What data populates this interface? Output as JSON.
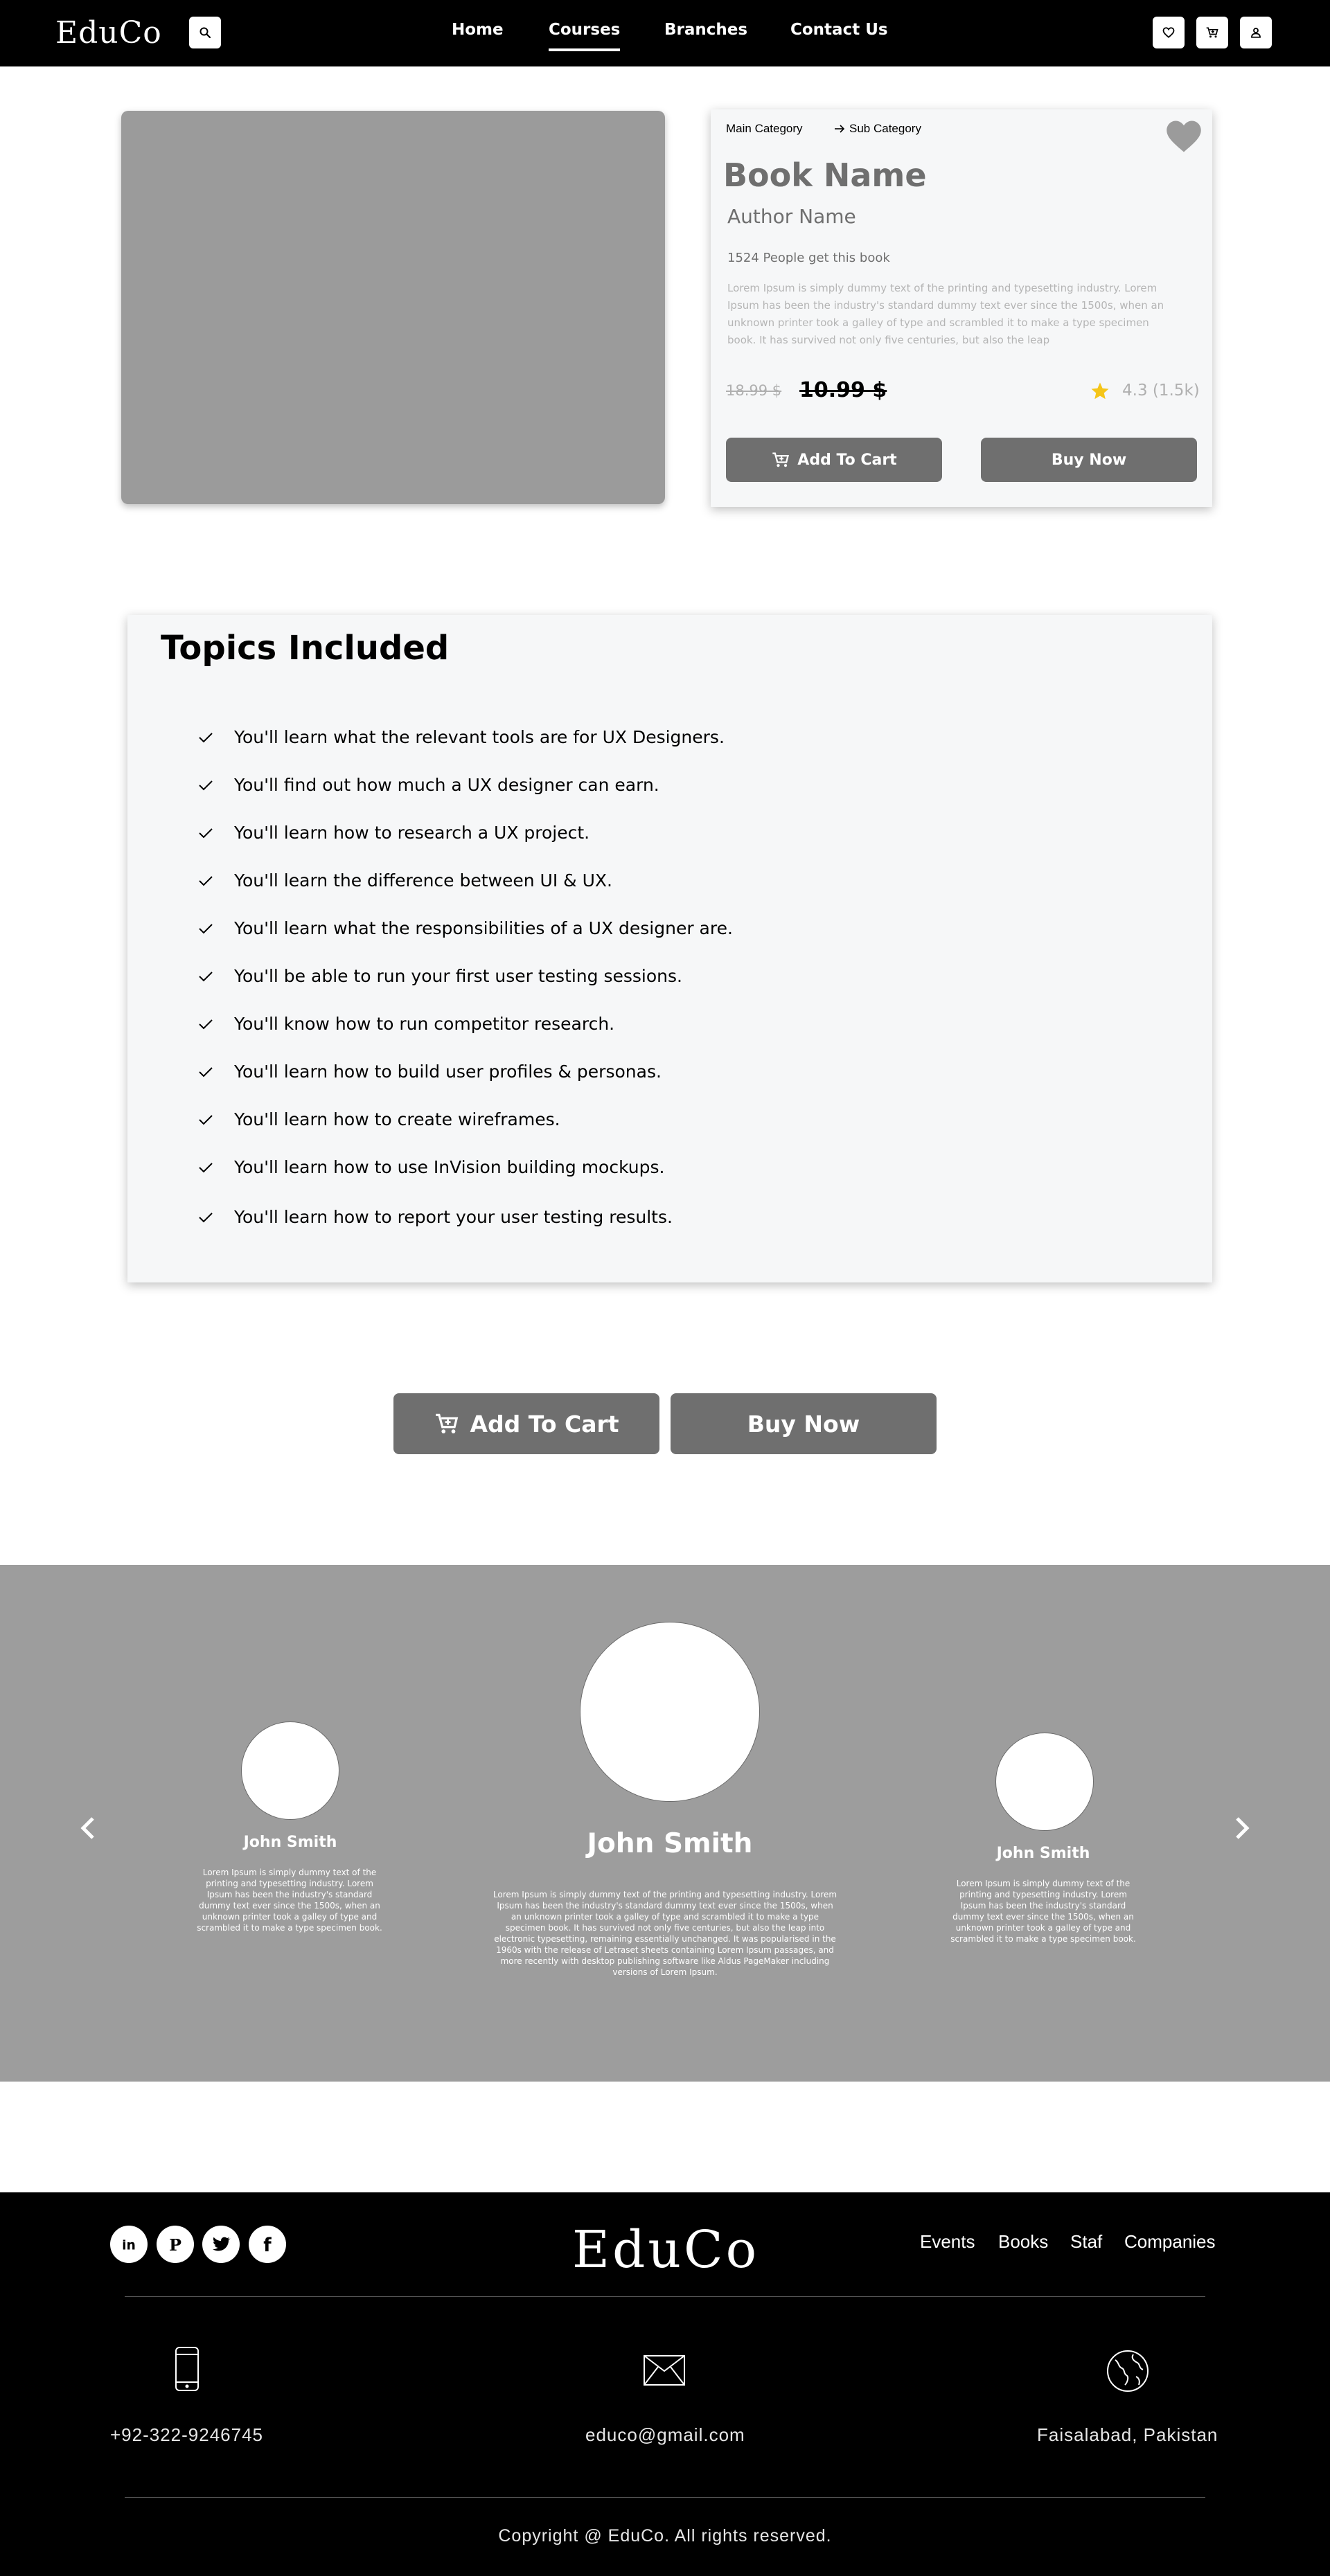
{
  "header": {
    "logo": "EduCo",
    "nav": [
      "Home",
      "Courses",
      "Branches",
      "Contact Us"
    ],
    "active_nav": "Courses",
    "icons": [
      "search-icon",
      "heart-icon",
      "cart-icon",
      "user-icon"
    ]
  },
  "product": {
    "breadcrumb_main": "Main Category",
    "breadcrumb_sub": "Sub Category",
    "book_name": "Book Name",
    "author_name": "Author Name",
    "people": "1524 People get this book",
    "description": "Lorem Ipsum is simply dummy text of the printing and typesetting industry. Lorem Ipsum has been the industry's standard dummy text ever since the 1500s, when an unknown printer took a galley of type and scrambled it to make a type specimen book. It has survived not only five centuries, but also the leap",
    "old_price": "18.99 $",
    "new_price": "10.99 $",
    "rating": "4.3 (1.5k)",
    "add_to_cart": "Add To Cart",
    "buy_now": "Buy Now",
    "accent_star": "#f5c518",
    "button_color": "#6f6f6f"
  },
  "topics": {
    "title": "Topics Included",
    "items": [
      "You'll learn what the relevant tools are for UX Designers.",
      "You'll find out how much a UX designer can earn.",
      "You'll learn how to research a UX project.",
      "You'll learn the difference between UI & UX.",
      "You'll learn what the responsibilities of a UX designer are.",
      "You'll be able to run your first user testing sessions.",
      "You'll know how to run competitor research.",
      "You'll learn how to build user profiles & personas.",
      "You'll learn how to create wireframes.",
      "You'll learn how to use InVision building mockups.",
      "You'll learn how to report your user testing results."
    ]
  },
  "actions": {
    "add_to_cart": "Add To Cart",
    "buy_now": "Buy Now"
  },
  "testimonials": {
    "left": {
      "name": "John Smith",
      "text": "Lorem Ipsum is simply dummy text of the printing and typesetting industry. Lorem Ipsum has been the industry's standard dummy text ever since the 1500s, when an unknown printer took a galley of type and scrambled it to make a type specimen book."
    },
    "center": {
      "name": "John Smith",
      "text": "Lorem Ipsum is simply dummy text of the printing and typesetting industry. Lorem Ipsum has been the industry's standard dummy text ever since the 1500s, when an unknown printer took a galley of type and scrambled it to make a type specimen book. It has survived not only five centuries, but also the leap into electronic typesetting, remaining essentially unchanged. It was popularised in the 1960s with the release of Letraset sheets containing Lorem Ipsum passages, and more recently with desktop publishing software like Aldus PageMaker including versions of Lorem Ipsum."
    },
    "right": {
      "name": "John Smith",
      "text": "Lorem Ipsum is simply dummy text of the printing and typesetting industry. Lorem Ipsum has been the industry's standard dummy text ever since the 1500s, when an unknown printer took a galley of type and scrambled it to make a type specimen book."
    },
    "background": "#9d9d9d"
  },
  "footer": {
    "logo": "EduCo",
    "social": [
      "linkedin-icon",
      "pinterest-icon",
      "twitter-icon",
      "facebook-icon"
    ],
    "links": [
      "Events",
      "Books",
      "Staf",
      "Companies"
    ],
    "phone": "+92-322-9246745",
    "email": "educo@gmail.com",
    "location": "Faisalabad, Pakistan",
    "copyright": "Copyright @ EduCo. All rights reserved."
  }
}
